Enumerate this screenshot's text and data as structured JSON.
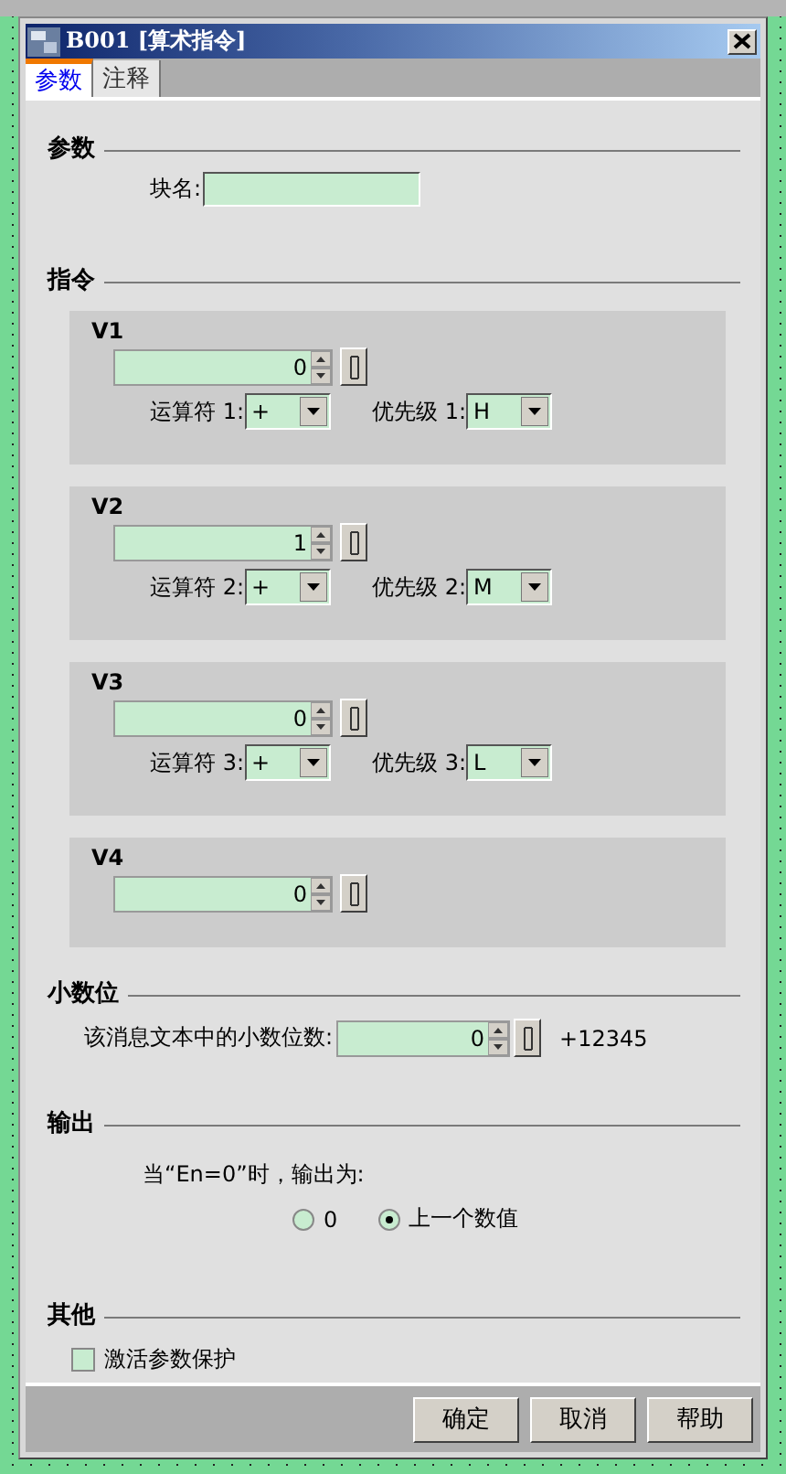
{
  "window": {
    "title": "B001 [算术指令]"
  },
  "tabs": [
    {
      "label": "参数",
      "selected": true
    },
    {
      "label": "注释",
      "selected": false
    }
  ],
  "parameters": {
    "heading": "参数",
    "block_name": {
      "label": "块名:"
    }
  },
  "instructions": {
    "heading": "指令",
    "groups": [
      {
        "name": "V1",
        "value": "0",
        "operator": {
          "label": "运算符 1:",
          "value": "+"
        },
        "priority": {
          "label": "优先级 1:",
          "value": "H"
        }
      },
      {
        "name": "V2",
        "value": "1",
        "operator": {
          "label": "运算符 2:",
          "value": "+"
        },
        "priority": {
          "label": "优先级 2:",
          "value": "M"
        }
      },
      {
        "name": "V3",
        "value": "0",
        "operator": {
          "label": "运算符 3:",
          "value": "+"
        },
        "priority": {
          "label": "优先级 3:",
          "value": "L"
        }
      },
      {
        "name": "V4",
        "value": "0"
      }
    ]
  },
  "decimal": {
    "heading": "小数位",
    "label": "该消息文本中的小数位数:",
    "value": "0",
    "preview": "+12345"
  },
  "output": {
    "heading": "输出",
    "prompt": "当“En=0”时，输出为:",
    "options": [
      {
        "label": "0",
        "selected": false
      },
      {
        "label": "上一个数值",
        "selected": true
      }
    ]
  },
  "other": {
    "heading": "其他",
    "checkbox": {
      "label": "激活参数保护",
      "checked": false
    }
  },
  "buttons": [
    "确定",
    "取消",
    "帮助"
  ]
}
